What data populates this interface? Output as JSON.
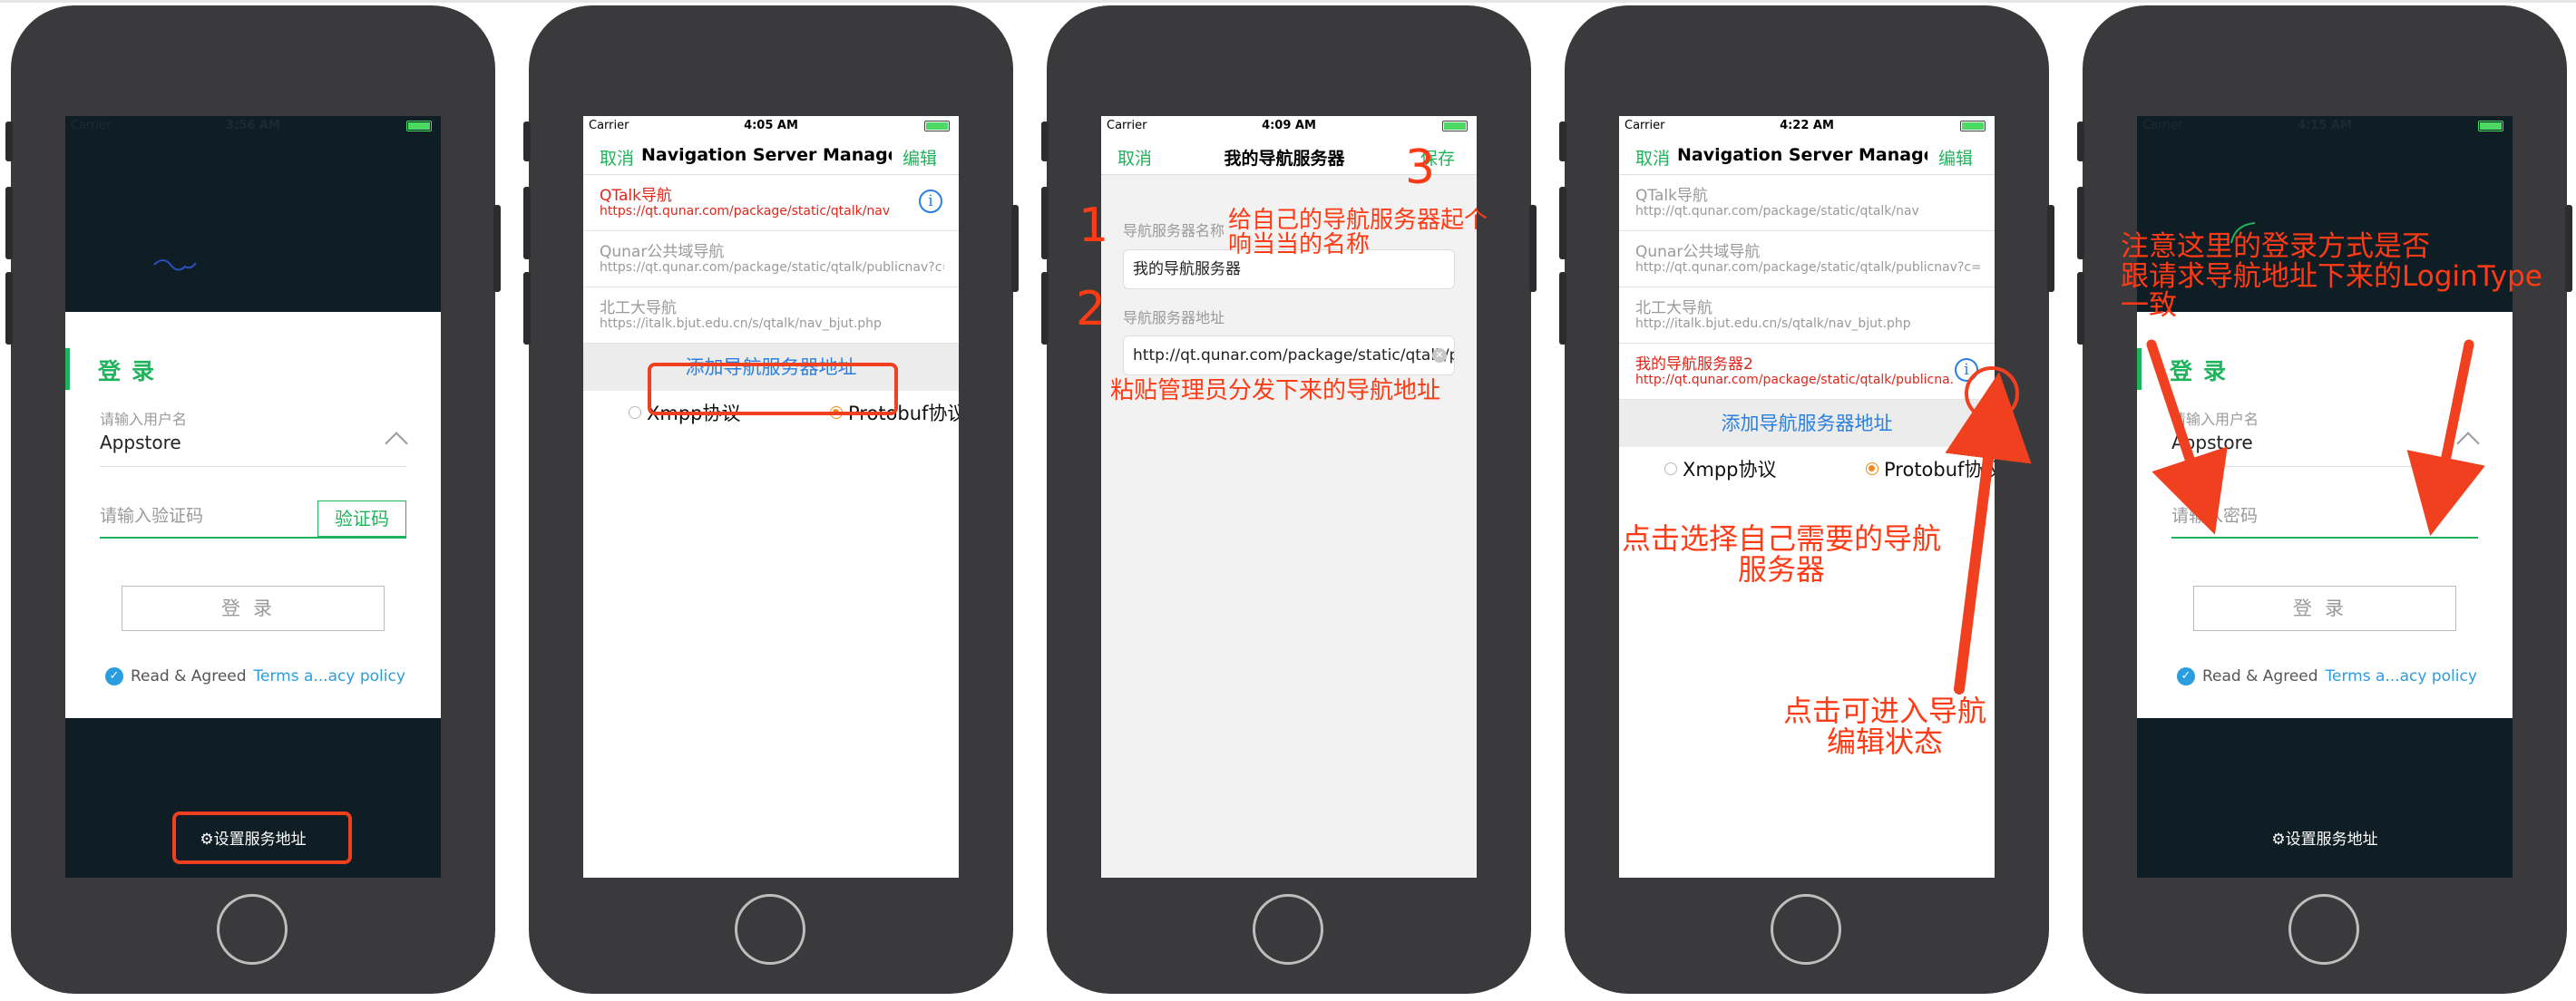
{
  "phones": [
    {
      "status": {
        "carrier": "Carrier",
        "time": "3:56 AM"
      },
      "login": {
        "title": "登录",
        "username_label": "请输入用户名",
        "username_value": "Appstore",
        "code_placeholder": "请输入验证码",
        "code_button": "验证码",
        "login_button": "登录",
        "agree_text": "Read & Agreed",
        "terms_link": "Terms a...acy policy"
      },
      "settings_link": "设置服务地址"
    },
    {
      "status": {
        "carrier": "Carrier",
        "time": "4:05 AM"
      },
      "nav": {
        "left": "取消",
        "title": "Navigation Server Managem...",
        "right": "编辑"
      },
      "servers": [
        {
          "name": "QTalk导航",
          "url": "https://qt.qunar.com/package/static/qtalk/nav"
        },
        {
          "name": "Qunar公共域导航",
          "url": "https://qt.qunar.com/package/static/qtalk/publicnav?c=..."
        },
        {
          "name": "北工大导航",
          "url": "https://italk.bjut.edu.cn/s/qtalk/nav_bjut.php"
        }
      ],
      "add_button": "添加导航服务器地址",
      "protocols": [
        "Xmpp协议",
        "Protobuf协议"
      ]
    },
    {
      "status": {
        "carrier": "Carrier",
        "time": "4:09 AM"
      },
      "nav": {
        "left": "取消",
        "title": "我的导航服务器",
        "right": "保存"
      },
      "name_label": "导航服务器名称",
      "name_value": "我的导航服务器",
      "addr_label": "导航服务器地址",
      "addr_value": "http://qt.qunar.com/package/static/qtalk/publ",
      "annotations": {
        "step1": "1",
        "step2": "2",
        "step3": "3",
        "note1": "给自己的导航服务器起个\n响当当的名称",
        "note2": "粘贴管理员分发下来的导航地址"
      }
    },
    {
      "status": {
        "carrier": "Carrier",
        "time": "4:22 AM"
      },
      "nav": {
        "left": "取消",
        "title": "Navigation Server Managem...",
        "right": "编辑"
      },
      "servers": [
        {
          "name": "QTalk导航",
          "url": "http://qt.qunar.com/package/static/qtalk/nav"
        },
        {
          "name": "Qunar公共域导航",
          "url": "http://qt.qunar.com/package/static/qtalk/publicnav?c=..."
        },
        {
          "name": "北工大导航",
          "url": "http://italk.bjut.edu.cn/s/qtalk/nav_bjut.php"
        },
        {
          "name": "我的导航服务器2",
          "url": "http://qt.qunar.com/package/static/qtalk/publicna..."
        }
      ],
      "add_button": "添加导航服务器地址",
      "protocols": [
        "Xmpp协议",
        "Protobuf协议"
      ],
      "annotations": {
        "choose": "点击选择自己需要的导航\n服务器",
        "edit": "点击可进入导航\n编辑状态"
      }
    },
    {
      "status": {
        "carrier": "Carrier",
        "time": "4:15 AM"
      },
      "login": {
        "title": "登录",
        "username_label": "请输入用户名",
        "username_value": "Appstore",
        "password_placeholder": "请输入密码",
        "login_button": "登录",
        "agree_text": "Read & Agreed",
        "terms_link": "Terms a...acy policy"
      },
      "settings_link": "设置服务地址",
      "annotations": {
        "note": "注意这里的登录方式是否\n跟请求导航地址下来的LoginType\n一致"
      }
    }
  ],
  "colors": {
    "accent_green": "#1fb35b",
    "link_blue": "#2a7fe0",
    "annotation_red": "#ff3b15",
    "dark_bg": "#0f1d25"
  }
}
